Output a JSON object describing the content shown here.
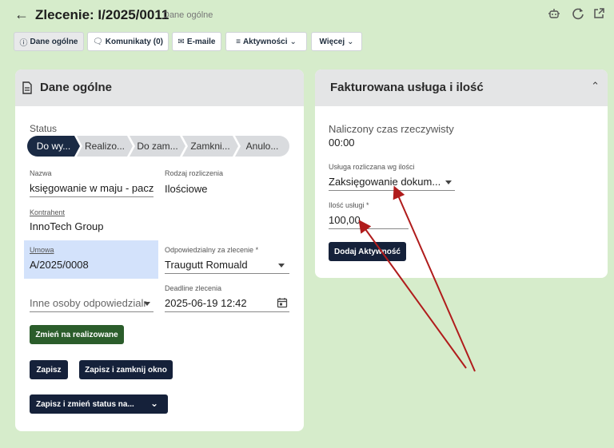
{
  "header": {
    "title": "Zlecenie: I/2025/0011",
    "subtitle": "Dane ogólne",
    "icons": [
      "robot-icon",
      "refresh-icon",
      "external-link-icon"
    ]
  },
  "tabs": [
    {
      "label": "Dane ogólne",
      "icon": "info-icon",
      "active": true
    },
    {
      "label": "Komunikaty (0)",
      "icon": "chat-icon"
    },
    {
      "label": "E-maile",
      "icon": "mail-icon"
    },
    {
      "label": "Aktywności",
      "icon": "list-icon",
      "dropdown": true
    },
    {
      "label": "Więcej",
      "dropdown": true
    }
  ],
  "general": {
    "title": "Dane ogólne",
    "status_label": "Status",
    "steps": [
      "Do wy...",
      "Realizo...",
      "Do zam...",
      "Zamkni...",
      "Anulo..."
    ],
    "name_label": "Nazwa",
    "name_value": "księgowanie w maju - paczka",
    "settlement_label": "Rodzaj rozliczenia",
    "settlement_value": "Ilościowe",
    "contractor_label": "Kontrahent",
    "contractor_value": "InnoTech Group",
    "contract_label": "Umowa",
    "contract_value": "A/2025/0008",
    "responsible_label": "Odpowiedzialny za zlecenie *",
    "responsible_value": "Traugutt Romuald",
    "others_placeholder": "Inne osoby odpowiedzialne",
    "deadline_label": "Deadline zlecenia",
    "deadline_value": "2025-06-19 12:42",
    "btn_change": "Zmień na realizowane",
    "btn_save": "Zapisz",
    "btn_save_close": "Zapisz i zamknij okno",
    "btn_save_status": "Zapisz i zmień status na..."
  },
  "billing": {
    "title": "Fakturowana usługa i ilość",
    "time_label": "Naliczony czas rzeczywisty",
    "time_value": "00:00",
    "service_label": "Usługa rozliczana wg ilości",
    "service_value": "Zaksięgowanie dokum...",
    "qty_label": "Ilość usługi *",
    "qty_value": "100,00",
    "btn_add": "Dodaj Aktywność"
  },
  "colors": {
    "background": "#d6eccb",
    "primary": "#15213a",
    "success": "#2b5d2b",
    "highlight": "#d3e2fb",
    "arrow": "#b01c1c"
  }
}
